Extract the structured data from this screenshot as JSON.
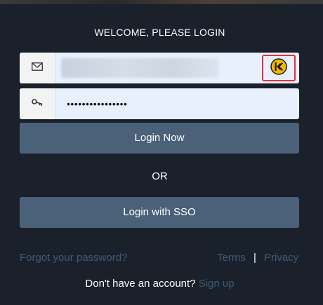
{
  "heading": "WELCOME, PLEASE LOGIN",
  "email_field": {
    "icon": "envelope-icon",
    "value_obscured": true,
    "autofill_icon": "keeper-logo-icon"
  },
  "password_field": {
    "icon": "key-icon",
    "value": "••••••••••••••••"
  },
  "login_button": "Login Now",
  "divider_text": "OR",
  "sso_button": "Login with SSO",
  "forgot_password": "Forgot your password?",
  "terms": "Terms",
  "separator": "|",
  "privacy": "Privacy",
  "no_account_text": "Don't have an account?",
  "signup_link": "Sign up",
  "colors": {
    "background": "#1a212b",
    "field_background": "#e8effd",
    "button": "#4b6079",
    "link": "#3e5a78",
    "highlight": "#e0343d",
    "logo_yellow": "#f5b800"
  }
}
